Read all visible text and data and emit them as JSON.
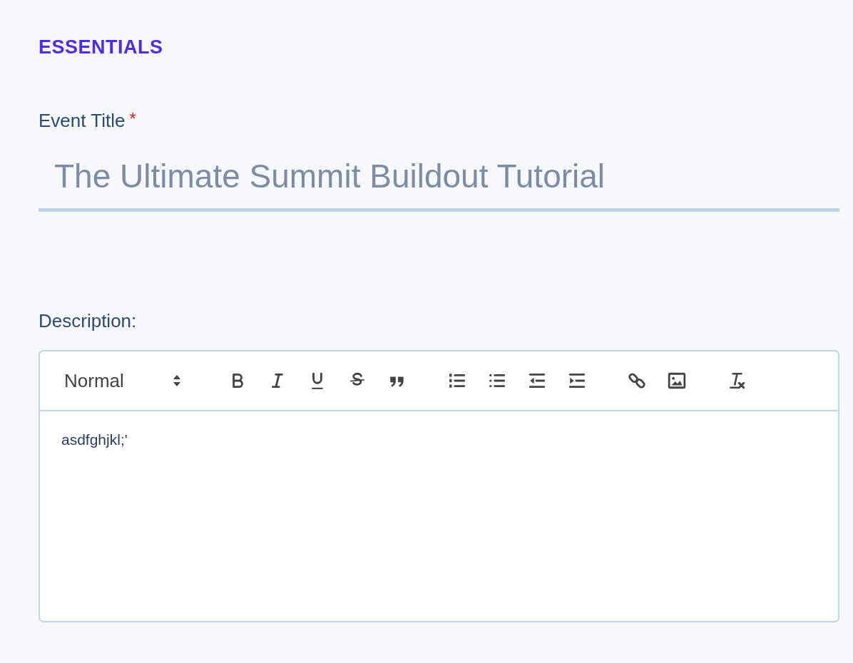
{
  "section_title": "ESSENTIALS",
  "title_field": {
    "label": "Event Title",
    "required_mark": "*",
    "value": "The Ultimate Summit Buildout Tutorial"
  },
  "description": {
    "label": "Description:",
    "format": "Normal",
    "content": "asdfghjkl;'"
  }
}
